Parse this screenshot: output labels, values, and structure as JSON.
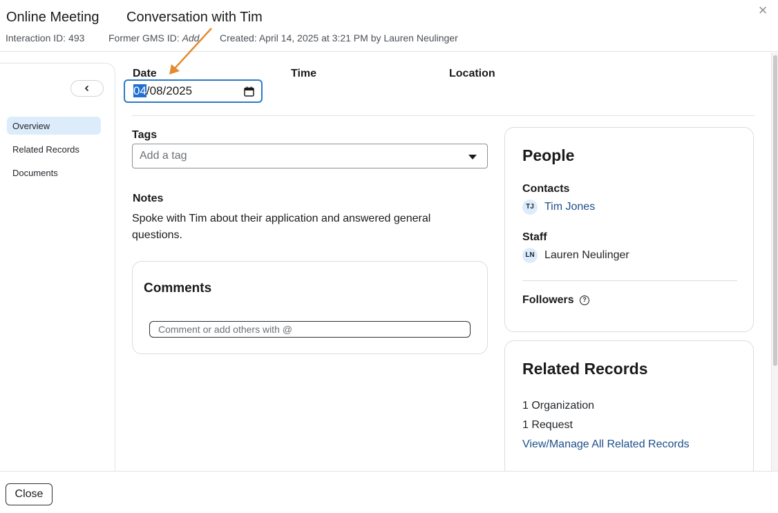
{
  "header": {
    "interaction_type": "Online Meeting",
    "title": "Conversation with Tim",
    "interaction_id": "Interaction ID: 493",
    "former_gms_label": "Former GMS ID: ",
    "former_gms_value": "Add",
    "created": "Created: April 14, 2025 at 3:21 PM by Lauren Neulinger"
  },
  "sidebar": {
    "items": [
      {
        "label": "Overview",
        "active": true
      },
      {
        "label": "Related Records",
        "active": false
      },
      {
        "label": "Documents",
        "active": false
      }
    ]
  },
  "details": {
    "date_label": "Date",
    "date_month": "04",
    "date_rest": "/08/2025",
    "time_label": "Time",
    "location_label": "Location"
  },
  "tags": {
    "label": "Tags",
    "placeholder": "Add a tag"
  },
  "notes": {
    "label": "Notes",
    "text": "Spoke with Tim about their application and answered general questions."
  },
  "comments": {
    "title": "Comments",
    "placeholder": "Comment or add others with @"
  },
  "people": {
    "title": "People",
    "contacts_label": "Contacts",
    "contacts": [
      {
        "initials": "TJ",
        "name": "Tim Jones"
      }
    ],
    "staff_label": "Staff",
    "staff": [
      {
        "initials": "LN",
        "name": "Lauren Neulinger"
      }
    ],
    "followers_label": "Followers",
    "help_glyph": "?"
  },
  "related_records": {
    "title": "Related Records",
    "organization": "1 Organization",
    "request": "1 Request",
    "manage_link": "View/Manage All Related Records"
  },
  "footer": {
    "close_label": "Close"
  },
  "icons": {
    "close": "×",
    "collapse": "chevron-left-icon",
    "calendar": "calendar-icon",
    "dropdown": "caret-down-icon"
  },
  "colors": {
    "accent": "#2a7ac7",
    "link": "#1d4f8a",
    "nav_active": "#dcecfb",
    "annotation_arrow": "#e38b2f"
  }
}
